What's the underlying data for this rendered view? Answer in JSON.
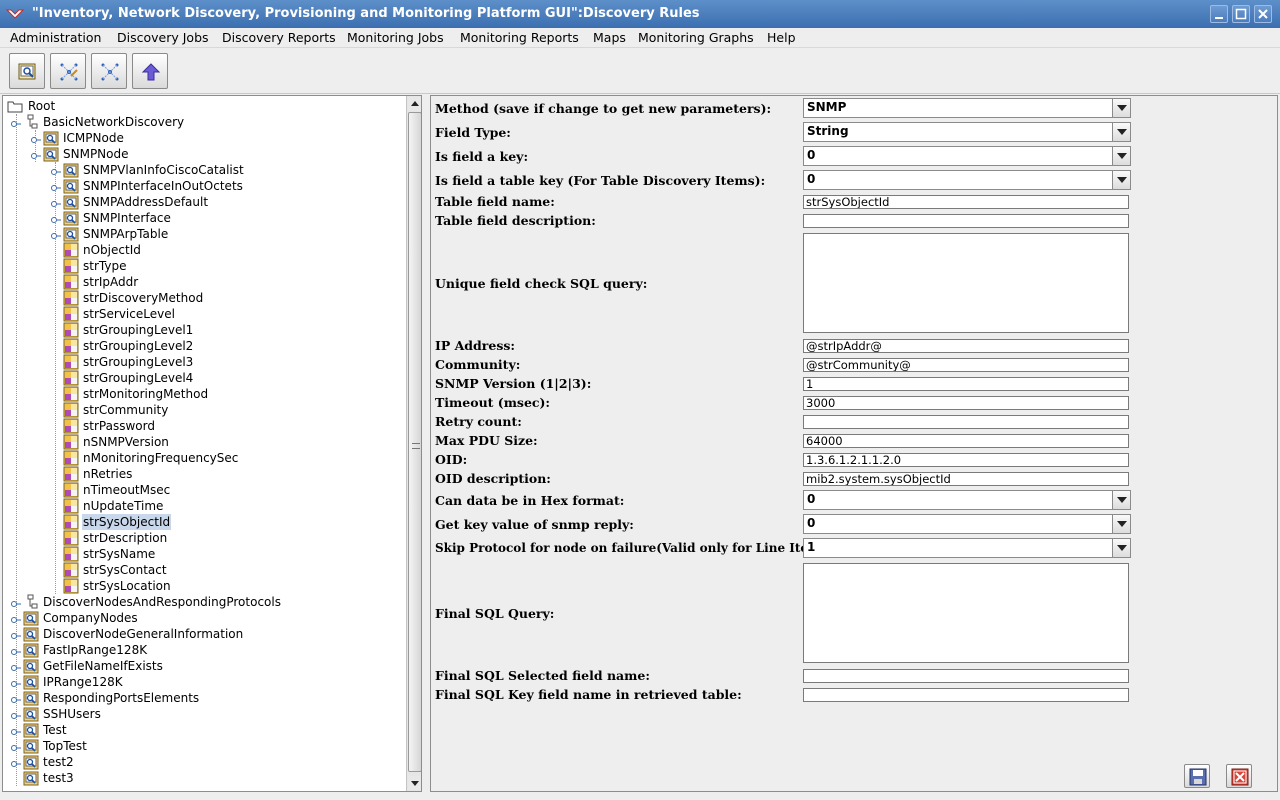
{
  "window": {
    "title": "\"Inventory, Network Discovery, Provisioning and Monitoring Platform GUI\":Discovery Rules"
  },
  "menu": [
    "Administration",
    "Discovery Jobs",
    "Discovery Reports",
    "Monitoring Jobs",
    "Monitoring Reports",
    "Maps",
    "Monitoring Graphs",
    "Help"
  ],
  "toolbar": {
    "icons": [
      "view-rules-icon",
      "edit-network-icon",
      "network-icon",
      "upload-arrow-icon"
    ]
  },
  "tree": {
    "root": "Root",
    "nodes": [
      {
        "label": "BasicNetworkDiscovery",
        "icon": "network-folder-icon"
      },
      {
        "label": "ICMPNode",
        "icon": "magnifier-node-icon"
      },
      {
        "label": "SNMPNode",
        "icon": "magnifier-node-icon"
      },
      {
        "label": "SNMPVlanInfoCiscoCatalist",
        "icon": "magnifier-node-icon"
      },
      {
        "label": "SNMPInterfaceInOutOctets",
        "icon": "magnifier-node-icon"
      },
      {
        "label": "SNMPAddressDefault",
        "icon": "magnifier-node-icon"
      },
      {
        "label": "SNMPInterface",
        "icon": "magnifier-node-icon"
      },
      {
        "label": "SNMPArpTable",
        "icon": "magnifier-node-icon"
      },
      {
        "label": "nObjectId",
        "icon": "field-icon"
      },
      {
        "label": "strType",
        "icon": "field-icon"
      },
      {
        "label": "strIpAddr",
        "icon": "field-icon"
      },
      {
        "label": "strDiscoveryMethod",
        "icon": "field-icon"
      },
      {
        "label": "strServiceLevel",
        "icon": "field-icon"
      },
      {
        "label": "strGroupingLevel1",
        "icon": "field-icon"
      },
      {
        "label": "strGroupingLevel2",
        "icon": "field-icon"
      },
      {
        "label": "strGroupingLevel3",
        "icon": "field-icon"
      },
      {
        "label": "strGroupingLevel4",
        "icon": "field-icon"
      },
      {
        "label": "strMonitoringMethod",
        "icon": "field-icon"
      },
      {
        "label": "strCommunity",
        "icon": "field-icon"
      },
      {
        "label": "strPassword",
        "icon": "field-icon"
      },
      {
        "label": "nSNMPVersion",
        "icon": "field-icon"
      },
      {
        "label": "nMonitoringFrequencySec",
        "icon": "field-icon"
      },
      {
        "label": "nRetries",
        "icon": "field-icon"
      },
      {
        "label": "nTimeoutMsec",
        "icon": "field-icon"
      },
      {
        "label": "nUpdateTime",
        "icon": "field-icon"
      },
      {
        "label": "strSysObjectId",
        "icon": "field-icon",
        "selected": true
      },
      {
        "label": "strDescription",
        "icon": "field-icon"
      },
      {
        "label": "strSysName",
        "icon": "field-icon"
      },
      {
        "label": "strSysContact",
        "icon": "field-icon"
      },
      {
        "label": "strSysLocation",
        "icon": "field-icon"
      },
      {
        "label": "DiscoverNodesAndRespondingProtocols",
        "icon": "network-folder-icon"
      },
      {
        "label": "CompanyNodes",
        "icon": "magnifier-node-icon"
      },
      {
        "label": "DiscoverNodeGeneralInformation",
        "icon": "magnifier-node-icon"
      },
      {
        "label": "FastIpRange128K",
        "icon": "magnifier-node-icon"
      },
      {
        "label": "GetFileNameIfExists",
        "icon": "magnifier-node-icon"
      },
      {
        "label": "IPRange128K",
        "icon": "magnifier-node-icon"
      },
      {
        "label": "RespondingPortsElements",
        "icon": "magnifier-node-icon"
      },
      {
        "label": "SSHUsers",
        "icon": "magnifier-node-icon"
      },
      {
        "label": "Test",
        "icon": "magnifier-node-icon"
      },
      {
        "label": "TopTest",
        "icon": "magnifier-node-icon"
      },
      {
        "label": "test2",
        "icon": "magnifier-node-icon"
      },
      {
        "label": "test3",
        "icon": "magnifier-node-icon"
      }
    ]
  },
  "form": {
    "method_label": "Method (save if change to get new parameters):",
    "method_value": "SNMP",
    "field_type_label": "Field Type:",
    "field_type_value": "String",
    "is_key_label": "Is field a key:",
    "is_key_value": "0",
    "is_table_key_label": "Is field a table key (For Table Discovery Items):",
    "is_table_key_value": "0",
    "table_field_name_label": "Table field name:",
    "table_field_name_value": "strSysObjectId",
    "table_field_desc_label": "Table field description:",
    "table_field_desc_value": "",
    "unique_sql_label": "Unique field check SQL query:",
    "unique_sql_value": "",
    "ip_label": "IP Address:",
    "ip_value": "@strIpAddr@",
    "community_label": "Community:",
    "community_value": "@strCommunity@",
    "snmp_version_label": "SNMP Version (1|2|3):",
    "snmp_version_value": "1",
    "timeout_label": "Timeout (msec):",
    "timeout_value": "3000",
    "retry_label": "Retry count:",
    "retry_value": "",
    "max_pdu_label": "Max PDU Size:",
    "max_pdu_value": "64000",
    "oid_label": "OID:",
    "oid_value": "1.3.6.1.2.1.1.2.0",
    "oid_desc_label": "OID description:",
    "oid_desc_value": "mib2.system.sysObjectId",
    "hex_label": "Can data be in Hex format:",
    "hex_value": "0",
    "key_value_label": "Get key value of snmp reply:",
    "key_value_value": "0",
    "skip_label": "Skip Protocol for node on failure(Valid only for Line Items)",
    "skip_value": "1",
    "final_sql_label": "Final SQL Query:",
    "final_sql_value": "",
    "final_selected_label": "Final SQL Selected field name:",
    "final_selected_value": "",
    "final_key_label": "Final SQL Key field name in retrieved table:",
    "final_key_value": ""
  },
  "buttons": {
    "save": "save-icon",
    "cancel": "cancel-icon"
  },
  "colors": {
    "titlebar": "#4a7dbd",
    "selection": "#c9d7ea",
    "cancel": "#c0392b"
  }
}
